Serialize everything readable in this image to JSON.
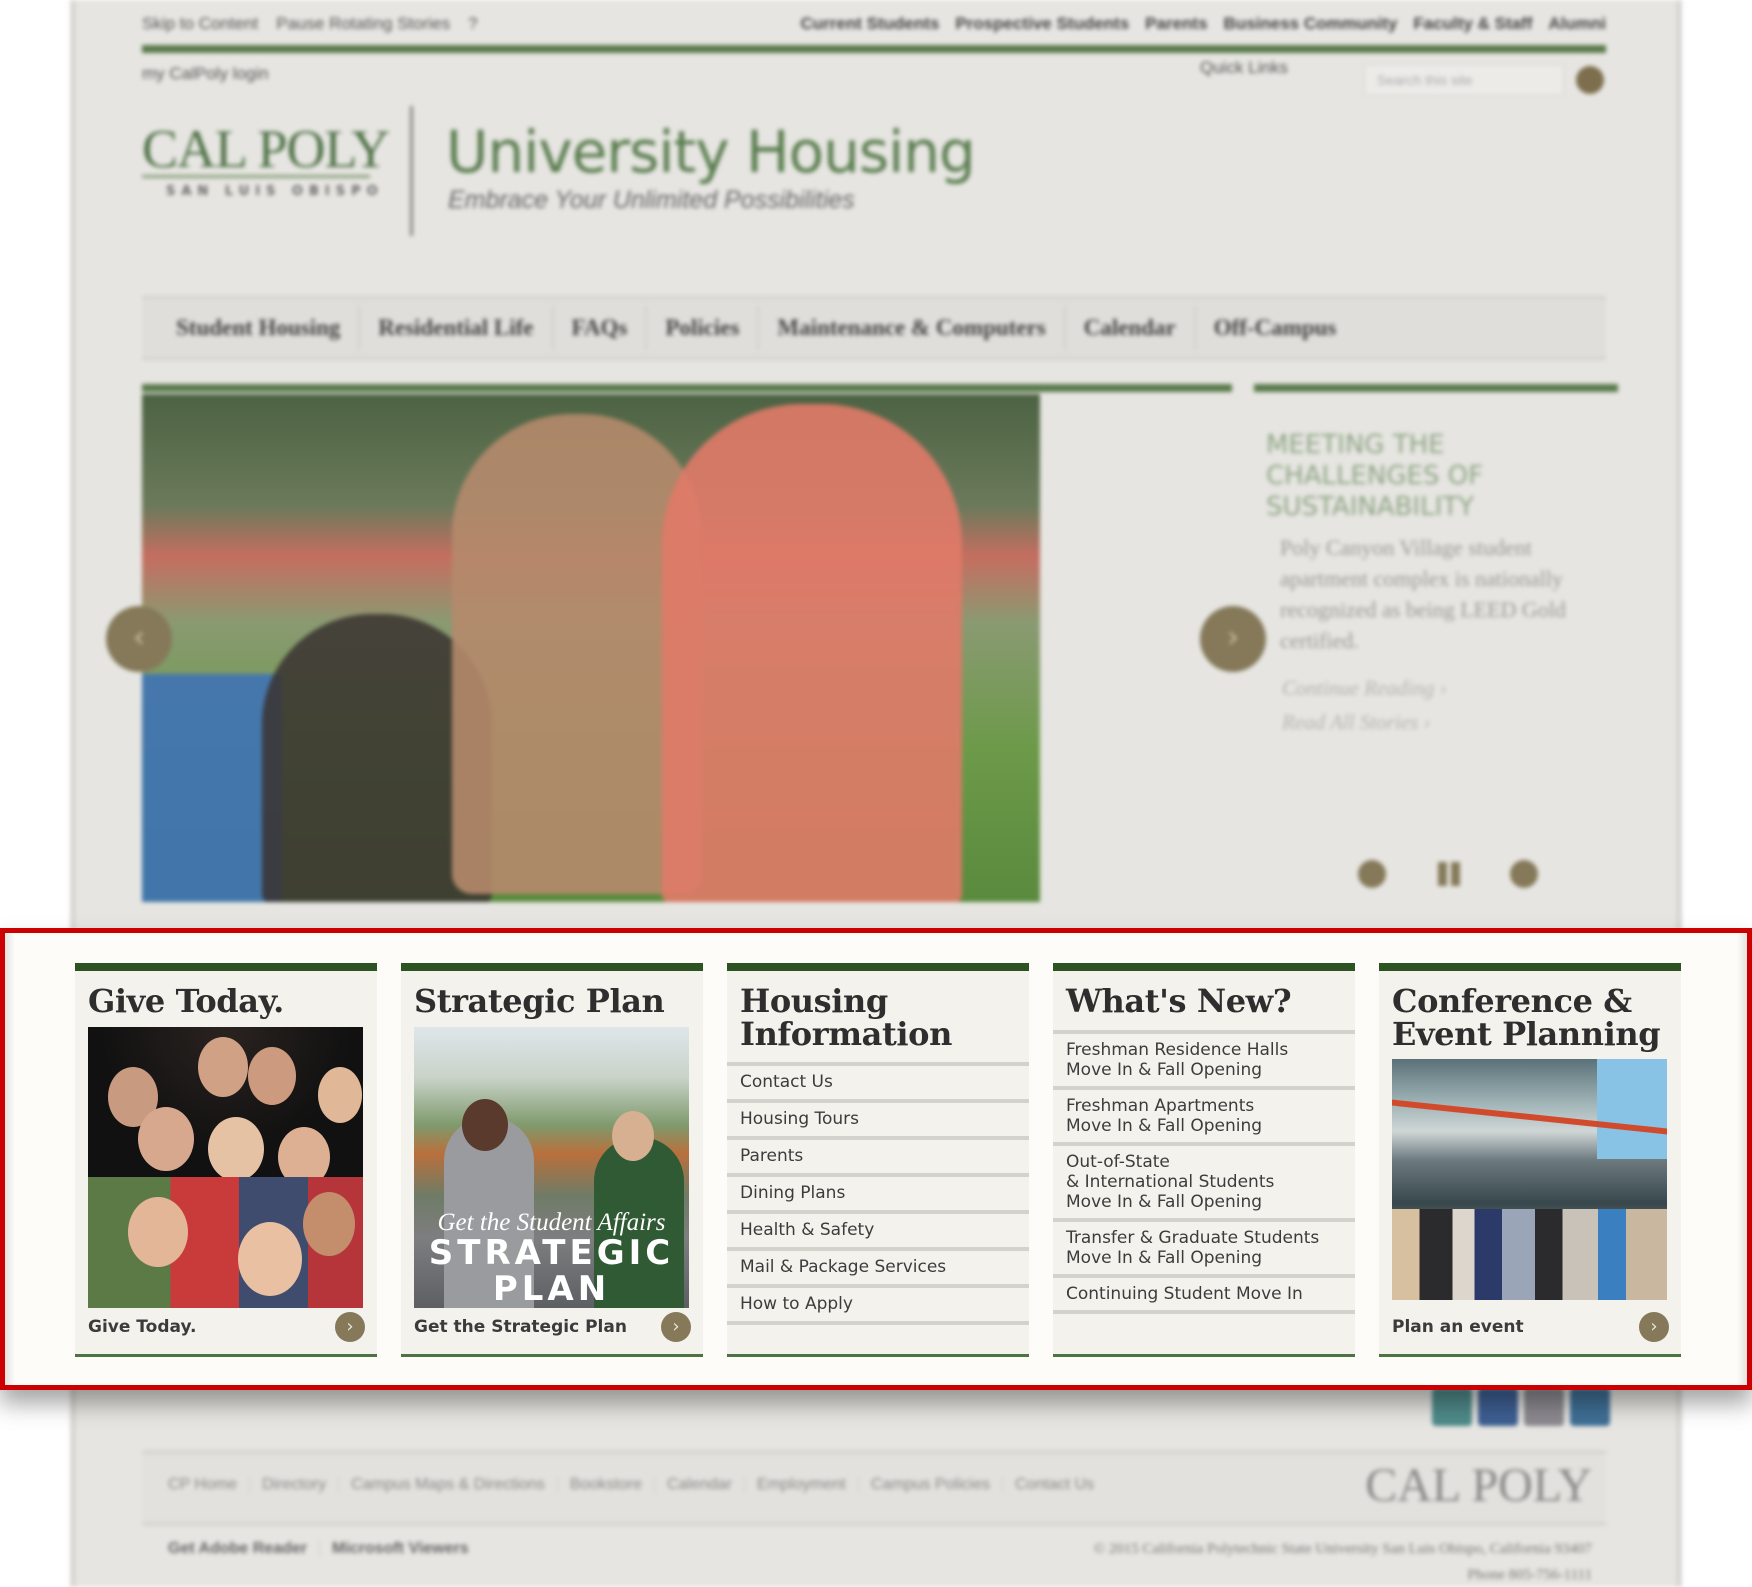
{
  "utility_nav": {
    "left": [
      "Skip to Content",
      "Pause Rotating Stories",
      "?"
    ],
    "right": [
      "Current Students",
      "Prospective Students",
      "Parents",
      "Business Community",
      "Faculty & Staff",
      "Alumni"
    ]
  },
  "header": {
    "my_login": "my CalPoly login",
    "quick_links": "Quick Links",
    "search_placeholder": "Search this site",
    "logo_main": "CAL POLY",
    "logo_sub": "SAN LUIS OBISPO",
    "site_title": "University Housing",
    "tagline": "Embrace Your Unlimited Possibilities"
  },
  "main_nav": [
    "Student Housing",
    "Residential Life",
    "FAQs",
    "Policies",
    "Maintenance & Computers",
    "Calendar",
    "Off-Campus"
  ],
  "slider": {
    "prev_icon": "‹",
    "next_icon": "›",
    "story_title": "MEETING THE CHALLENGES OF SUSTAINABILITY",
    "story_body": "Poly Canyon Village student apartment complex is nationally recognized as being LEED Gold certified.",
    "continue_link": "Continue Reading ›",
    "all_link": "Read All Stories ›"
  },
  "cards": {
    "give": {
      "title": "Give Today.",
      "footer_label": "Give Today.",
      "icon": "›"
    },
    "strategic": {
      "title": "Strategic Plan",
      "image_subtitle": "Get the Student Affairs",
      "image_title_1": "STRATEGIC",
      "image_title_2": "PLAN",
      "footer_label": "Get the Strategic Plan",
      "icon": "›"
    },
    "housing": {
      "title_1": "Housing",
      "title_2": "Information",
      "links": [
        "Contact Us",
        "Housing Tours",
        "Parents",
        "Dining Plans",
        "Health & Safety",
        "Mail & Package Services",
        "How to Apply"
      ]
    },
    "whats_new": {
      "title": "What's New?",
      "links": [
        [
          "Freshman Residence Halls",
          "Move In & Fall Opening"
        ],
        [
          "Freshman Apartments",
          "Move In & Fall Opening"
        ],
        [
          "Out-of-State",
          "& International Students",
          "Move In & Fall Opening"
        ],
        [
          "Transfer & Graduate Students",
          "Move In & Fall Opening"
        ],
        [
          "Continuing Student Move In"
        ]
      ]
    },
    "conference": {
      "title_1": "Conference &",
      "title_2": "Event Planning",
      "footer_label": "Plan an event",
      "icon": "›"
    }
  },
  "footer": {
    "links": [
      "CP Home",
      "Directory",
      "Campus Maps & Directions",
      "Bookstore",
      "Calendar",
      "Employment",
      "Campus Policies",
      "Contact Us"
    ],
    "links2": [
      "Get Adobe Reader",
      "Microsoft Viewers"
    ],
    "logo": "CAL POLY",
    "copyright": "© 2015 California Polytechnic State University   San Luis Obispo, California 93407",
    "phone": "Phone 805-756-1111"
  },
  "colors": {
    "brand_green": "#2d5322",
    "accent_brown": "#857959",
    "highlight_red": "#cc0000"
  }
}
